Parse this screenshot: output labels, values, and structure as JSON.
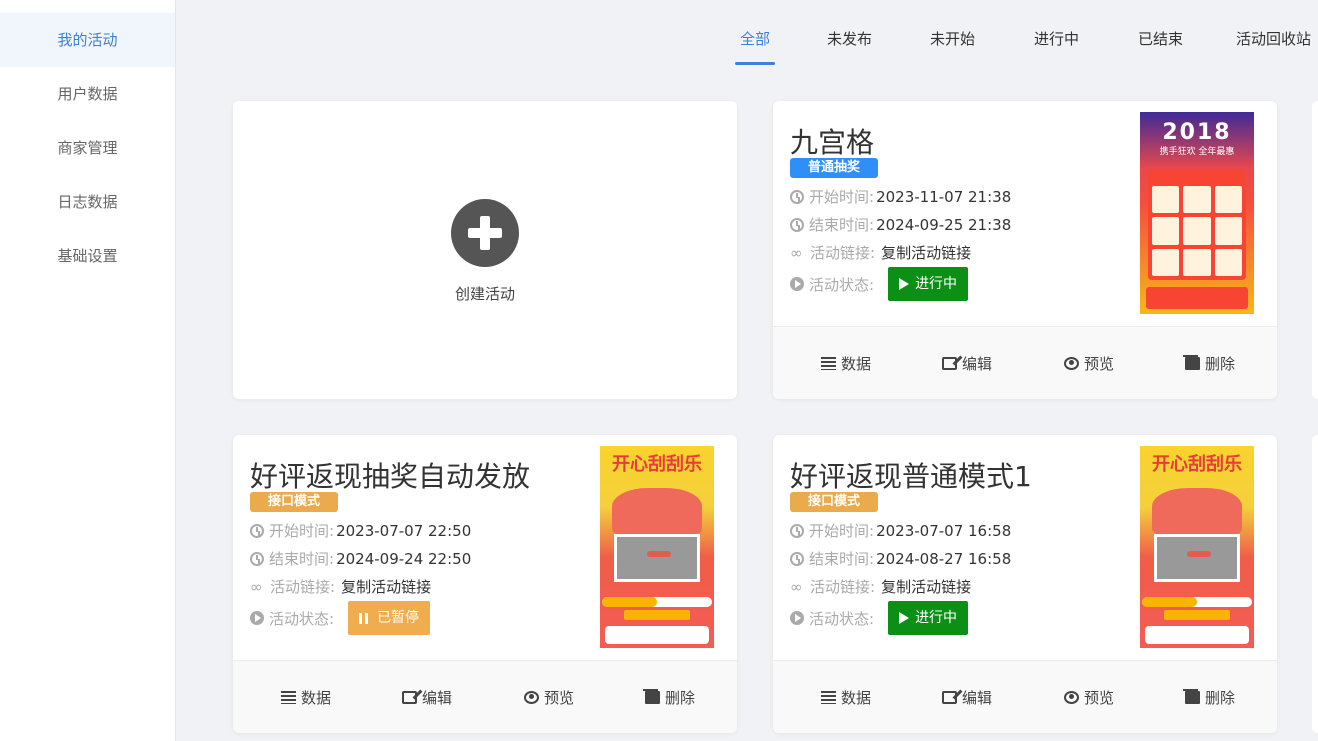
{
  "sidebar": {
    "items": [
      {
        "label": "我的活动",
        "active": true
      },
      {
        "label": "用户数据"
      },
      {
        "label": "商家管理"
      },
      {
        "label": "日志数据"
      },
      {
        "label": "基础设置"
      }
    ]
  },
  "tabs": [
    {
      "label": "全部",
      "active": true
    },
    {
      "label": "未发布"
    },
    {
      "label": "未开始"
    },
    {
      "label": "进行中"
    },
    {
      "label": "已结束"
    },
    {
      "label": "活动回收站"
    }
  ],
  "create": {
    "label": "创建活动"
  },
  "field_labels": {
    "start": "开始时间:",
    "end": "结束时间:",
    "link": "活动链接:",
    "status": "活动状态:"
  },
  "actions": {
    "data": "数据",
    "edit": "编辑",
    "preview": "预览",
    "delete": "删除"
  },
  "activities": [
    {
      "title": "九宫格",
      "badge": "普通抽奖",
      "badge_color": "#2f8ff6",
      "start": "2023-11-07 21:38",
      "end": "2024-09-25 21:38",
      "link": "复制活动链接",
      "status": "进行中",
      "status_color": "#0c8f15",
      "thumb": {
        "year": "2018",
        "sub": "携手狂欢 全年最惠"
      }
    },
    {
      "title": "好评返现抽奖自动发放",
      "badge": "接口模式",
      "badge_color": "#ebaa4b",
      "start": "2023-07-07 22:50",
      "end": "2024-09-24 22:50",
      "link": "复制活动链接",
      "status": "已暂停",
      "status_color": "#f0ad4e",
      "thumb": {
        "top": "开心刮刮乐"
      }
    },
    {
      "title": "好评返现普通模式1",
      "badge": "接口模式",
      "badge_color": "#ebaa4b",
      "start": "2023-07-07 16:58",
      "end": "2024-08-27 16:58",
      "link": "复制活动链接",
      "status": "进行中",
      "status_color": "#0c8f15",
      "thumb": {
        "top": "开心刮刮乐"
      }
    }
  ]
}
